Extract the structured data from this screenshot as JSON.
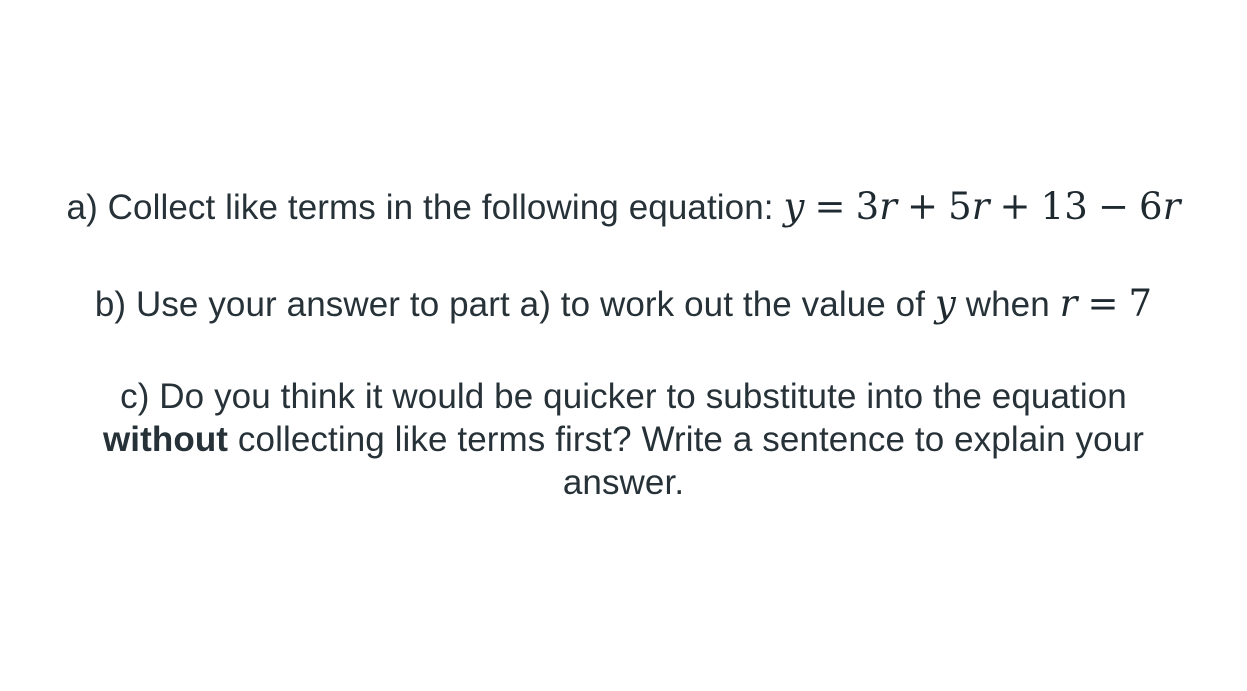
{
  "question": {
    "part_a": {
      "text": "a) Collect like terms in the following equation:",
      "equation": {
        "lhs": "y",
        "equals": "=",
        "t1_coef": "3",
        "t1_var": "r",
        "plus1": "+",
        "t2_coef": "5",
        "t2_var": "r",
        "plus2": "+",
        "t3": "13",
        "minus": "−",
        "t4_coef": "6",
        "t4_var": "r"
      }
    },
    "part_b": {
      "text_before": "b) Use your answer to part a) to work out the value of",
      "var_y": "y",
      "text_when": "when",
      "var_r": "r",
      "equals": "=",
      "value": "7"
    },
    "part_c": {
      "line1": "c) Do you think it would be quicker to substitute into the equation",
      "line2_bold": "without",
      "line2_rest": "collecting like terms first? Write a sentence to explain your",
      "line3": "answer."
    }
  }
}
